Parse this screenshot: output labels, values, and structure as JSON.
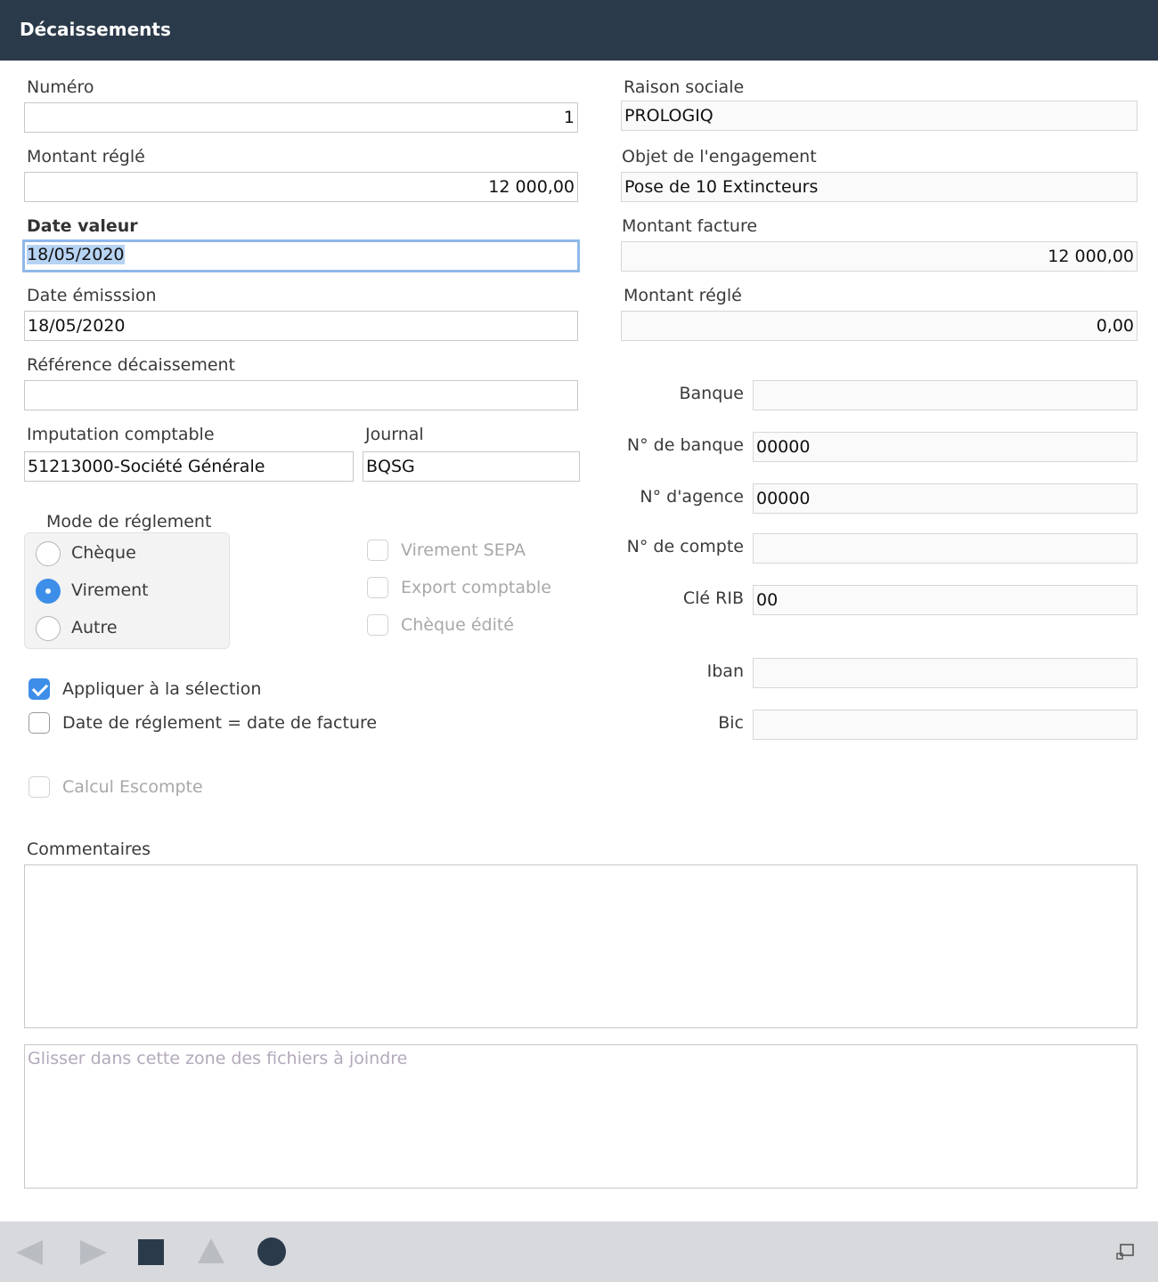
{
  "window": {
    "title": "Décaissements"
  },
  "left": {
    "numero": {
      "label": "Numéro",
      "value": "1"
    },
    "montant_regle": {
      "label": "Montant réglé",
      "value": "12 000,00"
    },
    "date_valeur": {
      "label": "Date valeur",
      "value": "18/05/2020"
    },
    "date_emission": {
      "label": "Date émisssion",
      "value": "18/05/2020"
    },
    "reference": {
      "label": "Référence décaissement",
      "value": ""
    },
    "imputation": {
      "label": "Imputation comptable",
      "value": "51213000-Société Générale"
    },
    "journal": {
      "label": "Journal",
      "value": "BQSG"
    }
  },
  "right": {
    "raison_sociale": {
      "label": "Raison sociale",
      "value": "PROLOGIQ"
    },
    "objet": {
      "label": "Objet de l'engagement",
      "value": "Pose de 10 Extincteurs"
    },
    "montant_facture": {
      "label": "Montant facture",
      "value": "12 000,00"
    },
    "montant_regle": {
      "label": "Montant réglé",
      "value": "0,00"
    }
  },
  "bank": {
    "banque": {
      "label": "Banque",
      "value": ""
    },
    "no_banque": {
      "label": "N° de banque",
      "value": "00000"
    },
    "no_agence": {
      "label": "N° d'agence",
      "value": "00000"
    },
    "no_compte": {
      "label": "N° de compte",
      "value": ""
    },
    "cle_rib": {
      "label": "Clé RIB",
      "value": "00"
    },
    "iban": {
      "label": "Iban",
      "value": ""
    },
    "bic": {
      "label": "Bic",
      "value": ""
    }
  },
  "mode_reglement": {
    "label": "Mode de réglement",
    "options": [
      {
        "label": "Chèque",
        "selected": false
      },
      {
        "label": "Virement",
        "selected": true
      },
      {
        "label": "Autre",
        "selected": false
      }
    ]
  },
  "status_checks": [
    {
      "label": "Virement SEPA",
      "checked": false,
      "enabled": false
    },
    {
      "label": "Export comptable",
      "checked": false,
      "enabled": false
    },
    {
      "label": "Chèque édité",
      "checked": false,
      "enabled": false
    }
  ],
  "options": {
    "appliquer": {
      "label": "Appliquer à la sélection",
      "checked": true
    },
    "date_reglement": {
      "label": "Date de réglement = date de facture",
      "checked": false
    },
    "calcul_escompte": {
      "label": "Calcul Escompte",
      "checked": false,
      "enabled": false
    }
  },
  "commentaires": {
    "label": "Commentaires",
    "value": ""
  },
  "attachments": {
    "placeholder": "Glisser dans cette zone des fichiers à joindre"
  },
  "colors": {
    "titlebar": "#2b3a4a",
    "accent": "#3d8ee8",
    "focus": "#8fb8ea",
    "footer": "#d7d9dd"
  },
  "footer_icons": [
    "previous-icon",
    "next-icon",
    "stop-icon",
    "up-icon",
    "record-icon",
    "resize-icon"
  ]
}
